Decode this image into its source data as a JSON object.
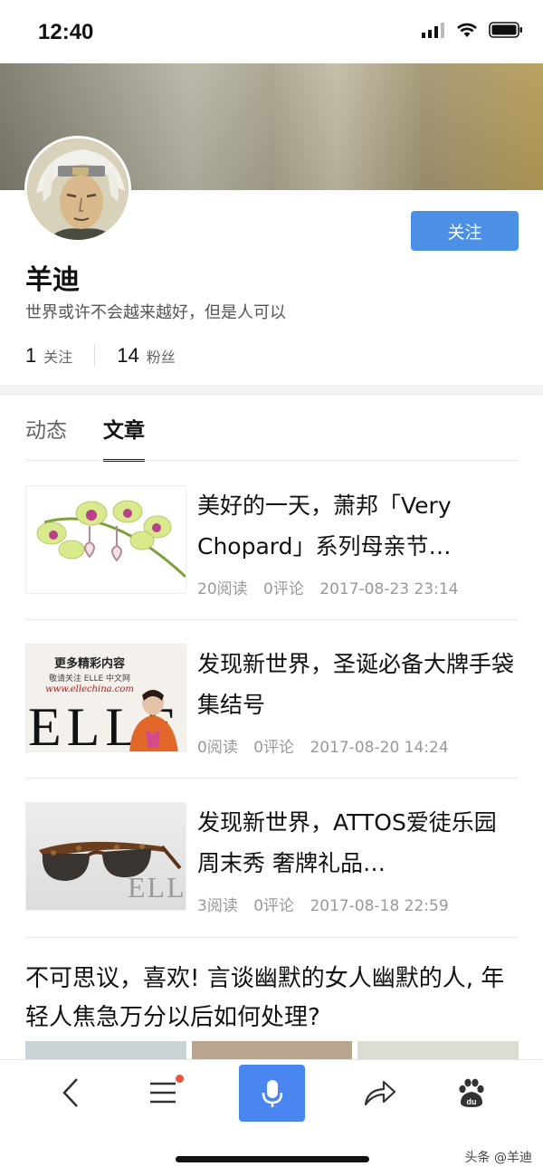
{
  "status_bar": {
    "time": "12:40"
  },
  "profile": {
    "name": "羊迪",
    "bio": "世界或许不会越来越好，但是人可以",
    "follow_label": "关注",
    "stats": [
      {
        "count": "1",
        "label": "关注"
      },
      {
        "count": "14",
        "label": "粉丝"
      }
    ]
  },
  "tabs": [
    {
      "label": "动态",
      "active": false
    },
    {
      "label": "文章",
      "active": true
    }
  ],
  "articles": [
    {
      "title": "美好的一天，萧邦「Very Chopard」系列母亲节…",
      "reads": "20阅读",
      "comments": "0评论",
      "date": "2017-08-23 23:14",
      "thumb_text": ""
    },
    {
      "title": "发现新世界，圣诞必备大牌手袋集结号",
      "reads": "0阅读",
      "comments": "0评论",
      "date": "2017-08-20 14:24",
      "thumb_text": {
        "line1": "更多精彩内容",
        "line2": "敬请关注 ELLE 中文网",
        "line3": "www.ellechina.com",
        "brand": "ELLE"
      }
    },
    {
      "title": "发现新世界，ATTOS爱徒乐园周末秀 奢牌礼品…",
      "reads": "3阅读",
      "comments": "0评论",
      "date": "2017-08-18 22:59",
      "thumb_text": {
        "brand": "ELLE"
      }
    }
  ],
  "bottom_article": {
    "title": "不可思议，喜欢! 言谈幽默的女人幽默的人, 年轻人焦急万分以后如何处理?"
  },
  "toolbar": {
    "items": [
      "back-icon",
      "menu-icon",
      "mic-icon",
      "share-icon",
      "baidu-paw-icon"
    ],
    "baidu_label": "du"
  },
  "watermark": "头条 @羊迪",
  "colors": {
    "primary": "#4c90e6",
    "mic_button": "#4a86f0",
    "badge": "#e9543e"
  }
}
